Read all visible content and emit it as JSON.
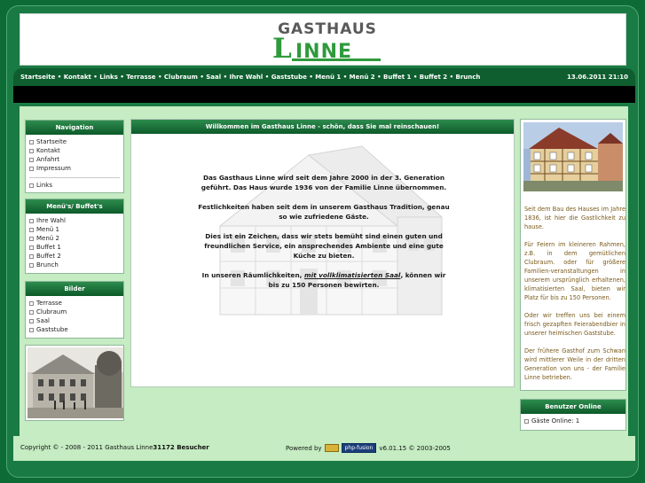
{
  "header": {
    "logo_top": "GASTHAUS",
    "logo_bottom_initial": "L",
    "logo_bottom_rest": "INNE"
  },
  "navbar": {
    "links": [
      "Startseite",
      "Kontakt",
      "Links",
      "Terrasse",
      "Clubraum",
      "Saal",
      "Ihre Wahl",
      "Gaststube",
      "Menü 1",
      "Menü 2",
      "Buffet 1",
      "Buffet 2",
      "Brunch"
    ],
    "separator": " • ",
    "datetime": "13.06.2011 21:10"
  },
  "sidebar_left": {
    "navigation": {
      "title": "Navigation",
      "items": [
        "Startseite",
        "Kontakt",
        "Anfahrt",
        "Impressum"
      ],
      "extra": [
        "Links"
      ]
    },
    "menus": {
      "title": "Menü's/ Buffet's",
      "items": [
        "Ihre Wahl",
        "Menü 1",
        "Menü 2",
        "Buffet 1",
        "Buffet 2",
        "Brunch"
      ]
    },
    "bilder": {
      "title": "Bilder",
      "items": [
        "Terrasse",
        "Clubraum",
        "Saal",
        "Gaststube"
      ]
    }
  },
  "main": {
    "title": "Willkommen im Gasthaus Linne - schön, dass Sie mal reinschauen!",
    "paragraphs": [
      "Das Gasthaus Linne wird seit dem Jahre 2000 in der 3. Generation geführt. Das Haus wurde 1936 von der Familie Linne übernommen.",
      "Festlichkeiten haben seit dem in unserem Gasthaus Tradition, genau so wie zufriedene Gäste.",
      "Dies ist ein Zeichen, dass wir stets bemüht sind einen guten und freundlichen Service, ein ansprechendes Ambiente und eine gute Küche zu bieten."
    ],
    "last_before": "In unseren Räumlichkeiten, ",
    "last_link": "mit vollklimatisierten Saal",
    "last_after": ", können wir bis zu 150 Personen bewirten."
  },
  "sidebar_right": {
    "paragraphs": [
      "Seit dem Bau des Hauses im Jahre 1836, ist hier die Gastlichkeit zu hause.",
      "Für Feiern im kleineren Rahmen, z.B. in dem gemütlichen Clubraum. oder für größere Familien-veranstaltungen in unserem ursprünglich erhaltenen, klimatisierten Saal, bieten wir Platz für bis zu 150 Personen.",
      "Oder wir treffen uns bei einem frisch gezapften Feierabendbier in unserer heimischen Gaststube.",
      "Der frühere Gasthof zum Schwan wird mittlerer Weile in der dritten Generation von uns - der Familie Linne betrieben."
    ],
    "online": {
      "title": "Benutzer Online",
      "guests": "Gäste Online: 1"
    }
  },
  "footer": {
    "copyright": "Copyright © - 2008 - 2011 Gasthaus Linne",
    "visitors": "31172 Besucher",
    "powered_label": "Powered by",
    "badge": "php-fusion",
    "version": "v6.01.15 © 2003-2005"
  },
  "colors": {
    "background": "#0d6b36",
    "content_bg": "#c5ecc2",
    "title_bar": "#0c5a29",
    "logo_green": "#2f9a3c"
  }
}
